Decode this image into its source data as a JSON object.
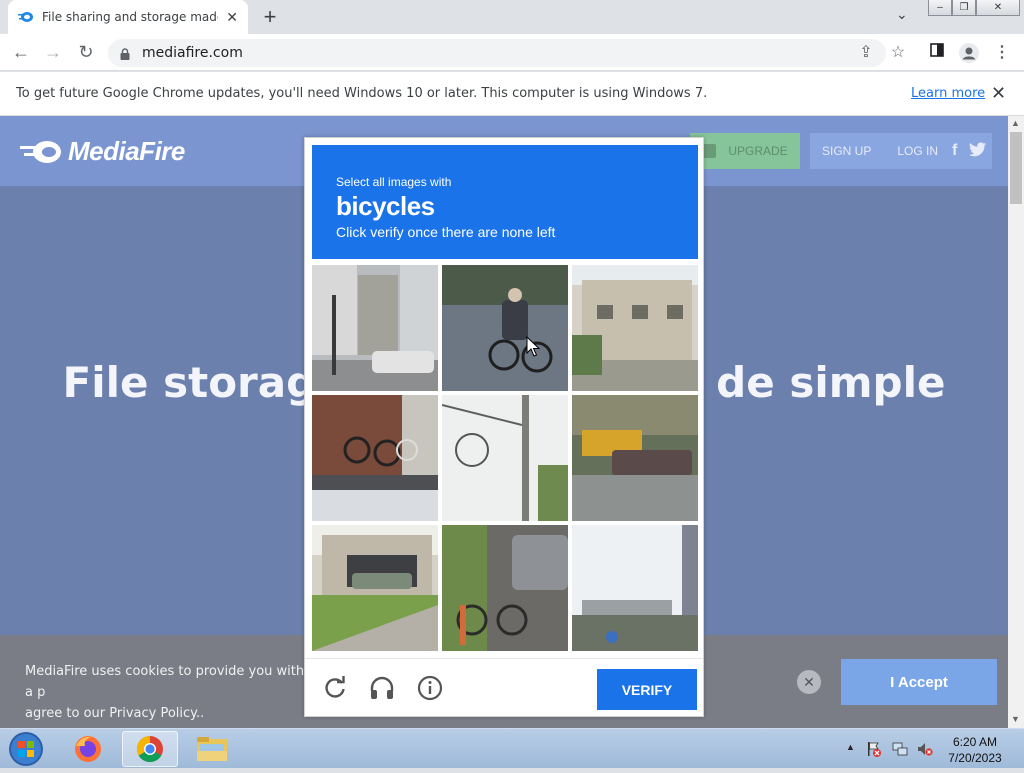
{
  "browser": {
    "tab_title": "File sharing and storage made simple",
    "url": "mediafire.com",
    "new_tab_label": "+",
    "infobar_text": "To get future Google Chrome updates, you'll need Windows 10 or later. This computer is using Windows 7.",
    "learn_more": "Learn more"
  },
  "site": {
    "logo_text": "MediaFire",
    "upgrade": "UPGRADE",
    "sign_up": "SIGN UP",
    "log_in": "LOG IN",
    "hero_left": "File storag",
    "hero_right": "de simple",
    "cookie_line1": "MediaFire uses cookies to provide you with a p",
    "cookie_line2": "agree to our Privacy Policy..",
    "accept": "I Accept"
  },
  "captcha": {
    "line1": "Select all images with",
    "target": "bicycles",
    "line3": "Click verify once there are none left",
    "verify": "VERIFY",
    "tiles": [
      "street-intersection",
      "person-riding-bicycle",
      "apartment-building",
      "parked-bicycles",
      "street-lamp-pole",
      "school-bus-street",
      "house-driveway",
      "bicycle-near-car",
      "city-buildings"
    ]
  },
  "taskbar": {
    "time": "6:20 AM",
    "date": "7/20/2023"
  },
  "colors": {
    "captcha_blue": "#1a73e8",
    "page_overlay": "#6c80ae",
    "chrome_gray": "#dee1e6"
  }
}
